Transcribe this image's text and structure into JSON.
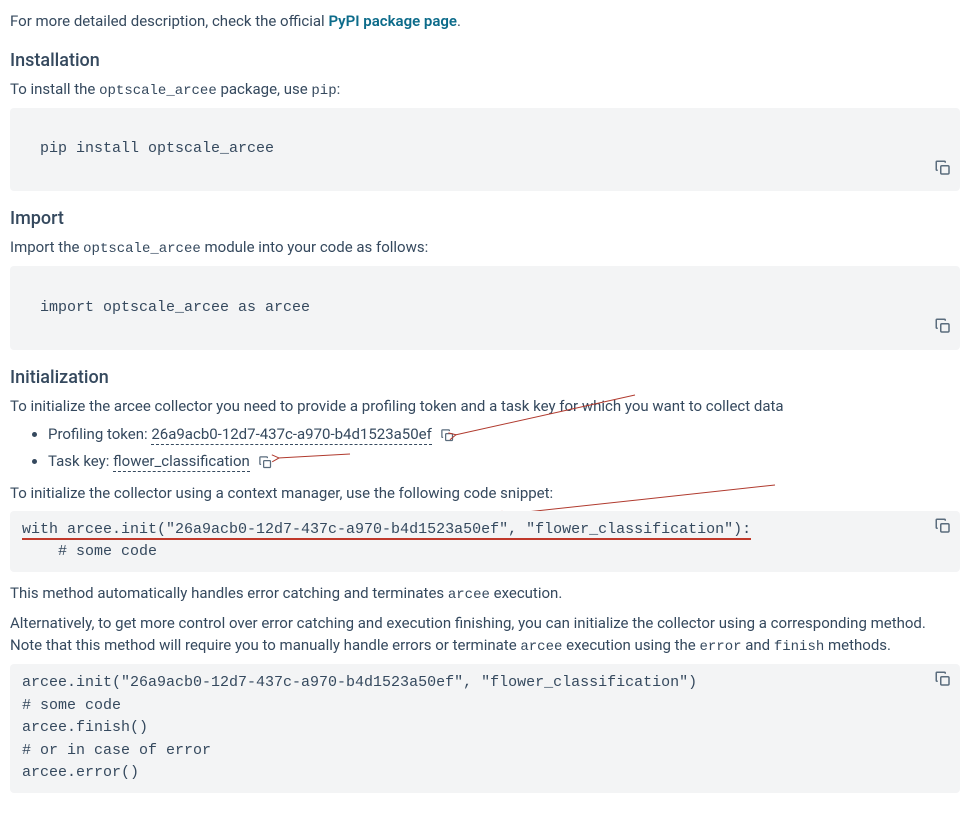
{
  "intro": {
    "prefix": "For more detailed description, check the official ",
    "link": "PyPI package page",
    "suffix": "."
  },
  "installation": {
    "heading": "Installation",
    "text_prefix": "To install the ",
    "pkg": "optscale_arcee",
    "text_mid": " package, use ",
    "tool": "pip",
    "text_suffix": ":",
    "code": "pip install optscale_arcee"
  },
  "import": {
    "heading": "Import",
    "text_prefix": "Import the ",
    "pkg": "optscale_arcee",
    "text_suffix": " module into your code as follows:",
    "code": "import optscale_arcee as arcee"
  },
  "init": {
    "heading": "Initialization",
    "intro": "To initialize the arcee collector you need to provide a profiling token and a task key for which you want to collect data",
    "token_label": "Profiling token: ",
    "token_value": "26a9acb0-12d7-437c-a970-b4d1523a50ef",
    "task_label": "Task key: ",
    "task_value": "flower_classification",
    "context_text": "To initialize the collector using a context manager, use the following code snippet:",
    "code1_a": "with arcee.init(\"26a9acb0-12d7-437c-a970-b4d1523a50ef\", \"flower_classification\"):",
    "code1_b": "    # some code",
    "method_text_a": "This method automatically handles error catching and terminates ",
    "method_code_a": "arcee",
    "method_text_b": " execution.",
    "alt_text_a": "Alternatively, to get more control over error catching and execution finishing, you can initialize the collector using a corresponding method. Note that this method will require you to manually handle errors or terminate ",
    "alt_code_a": "arcee",
    "alt_text_b": " execution using the ",
    "alt_code_b": "error",
    "alt_text_c": " and ",
    "alt_code_c": "finish",
    "alt_text_d": " methods.",
    "code2": "arcee.init(\"26a9acb0-12d7-437c-a970-b4d1523a50ef\", \"flower_classification\")\n# some code\narcee.finish()\n# or in case of error\narcee.error()"
  }
}
